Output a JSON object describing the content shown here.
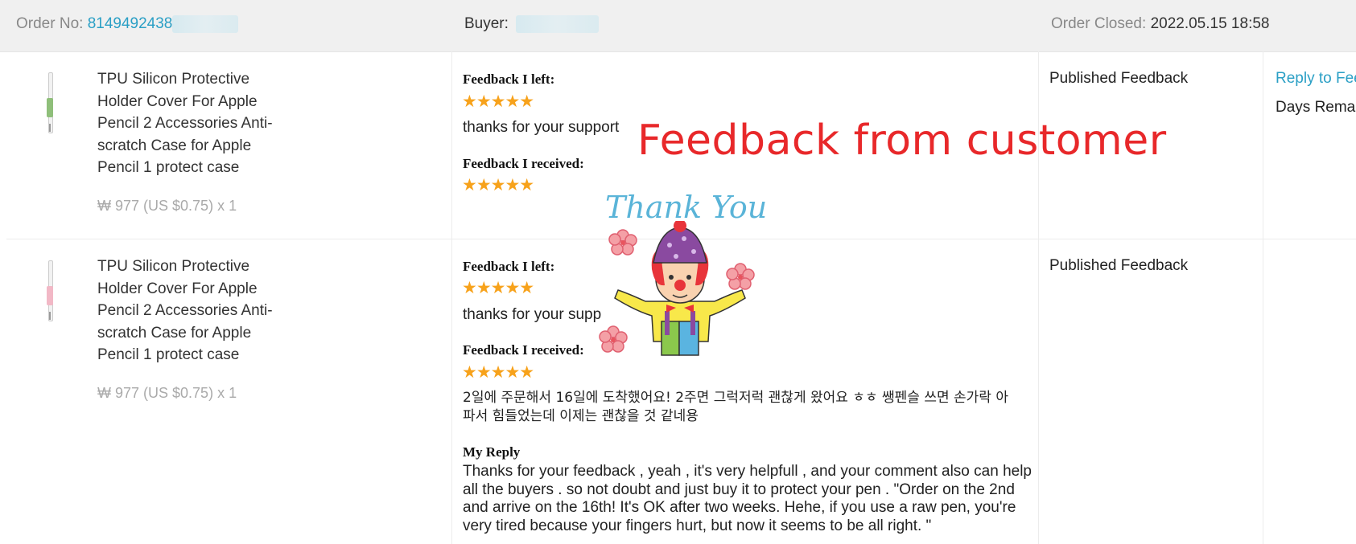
{
  "header": {
    "order_no_label": "Order No:",
    "order_no_value": "8149492438",
    "buyer_label": "Buyer:",
    "order_closed_label": "Order Closed:",
    "order_closed_value": "2022.05.15 18:58"
  },
  "orders": [
    {
      "product_title": "TPU Silicon Protective Holder Cover For Apple Pencil 2 Accessories Anti-scratch Case for Apple Pencil 1 protect case",
      "price": "₩ 977 (US $0.75) x 1",
      "grip_color": "#8fbf7a",
      "feedback_left_label": "Feedback I left:",
      "feedback_left_stars": "★★★★★",
      "feedback_left_text": "thanks for your support",
      "feedback_received_label": "Feedback I received:",
      "feedback_received_stars": "★★★★★",
      "status": "Published Feedback",
      "reply_link": "Reply to Fee",
      "days_remaining": "Days Remai"
    },
    {
      "product_title": "TPU Silicon Protective Holder Cover For Apple Pencil 2 Accessories Anti-scratch Case for Apple Pencil 1 protect case",
      "price": "₩ 977 (US $0.75) x 1",
      "grip_color": "#f2b8c6",
      "feedback_left_label": "Feedback I left:",
      "feedback_left_stars": "★★★★★",
      "feedback_left_text": "thanks for your supp",
      "feedback_received_label": "Feedback I received:",
      "feedback_received_stars": "★★★★★",
      "received_comment": "2일에 주문해서 16일에 도착했어요! 2주면 그럭저럭 괜찮게 왔어요 ㅎㅎ 쌩펜슬 쓰면 손가락 아파서 힘들었는데 이제는 괜찮을 것 같네용",
      "my_reply_label": "My Reply",
      "my_reply_text": "Thanks for your feedback , yeah , it's very helpfull , and your comment also can help all the buyers . so not doubt and just buy it to protect your pen . \"Order on the 2nd and arrive on the 16th! It's OK after two weeks. Hehe, if you use a raw pen, you're very tired because your fingers hurt, but now it seems to be all right. \"",
      "status": "Published Feedback"
    }
  ],
  "overlay": {
    "title": "Feedback from customer",
    "sticker_text": "Thank You"
  },
  "colors": {
    "link": "#2a9fc5",
    "stars": "#f7a21b",
    "overlay_title": "#e8282a",
    "header_bg": "#f0f0f0"
  }
}
